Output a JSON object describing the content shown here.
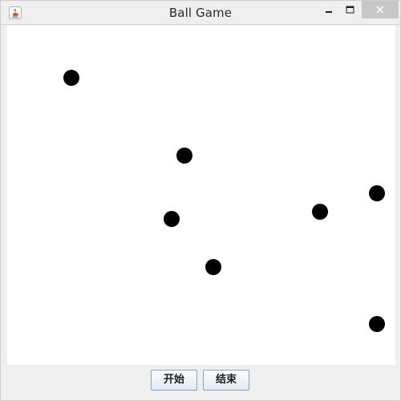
{
  "window": {
    "title": "Ball Game",
    "icon": "java-cup-icon"
  },
  "title_bar": {
    "minimize_icon": "minimize-icon",
    "maximize_icon": "maximize-icon",
    "close_icon": "close-icon",
    "close_button_color": "#c7c7c7"
  },
  "game": {
    "ball_color": "#000000",
    "ball_count": 7,
    "background_color": "#ffffff"
  },
  "controls": {
    "start_label": "开始",
    "end_label": "结束"
  }
}
